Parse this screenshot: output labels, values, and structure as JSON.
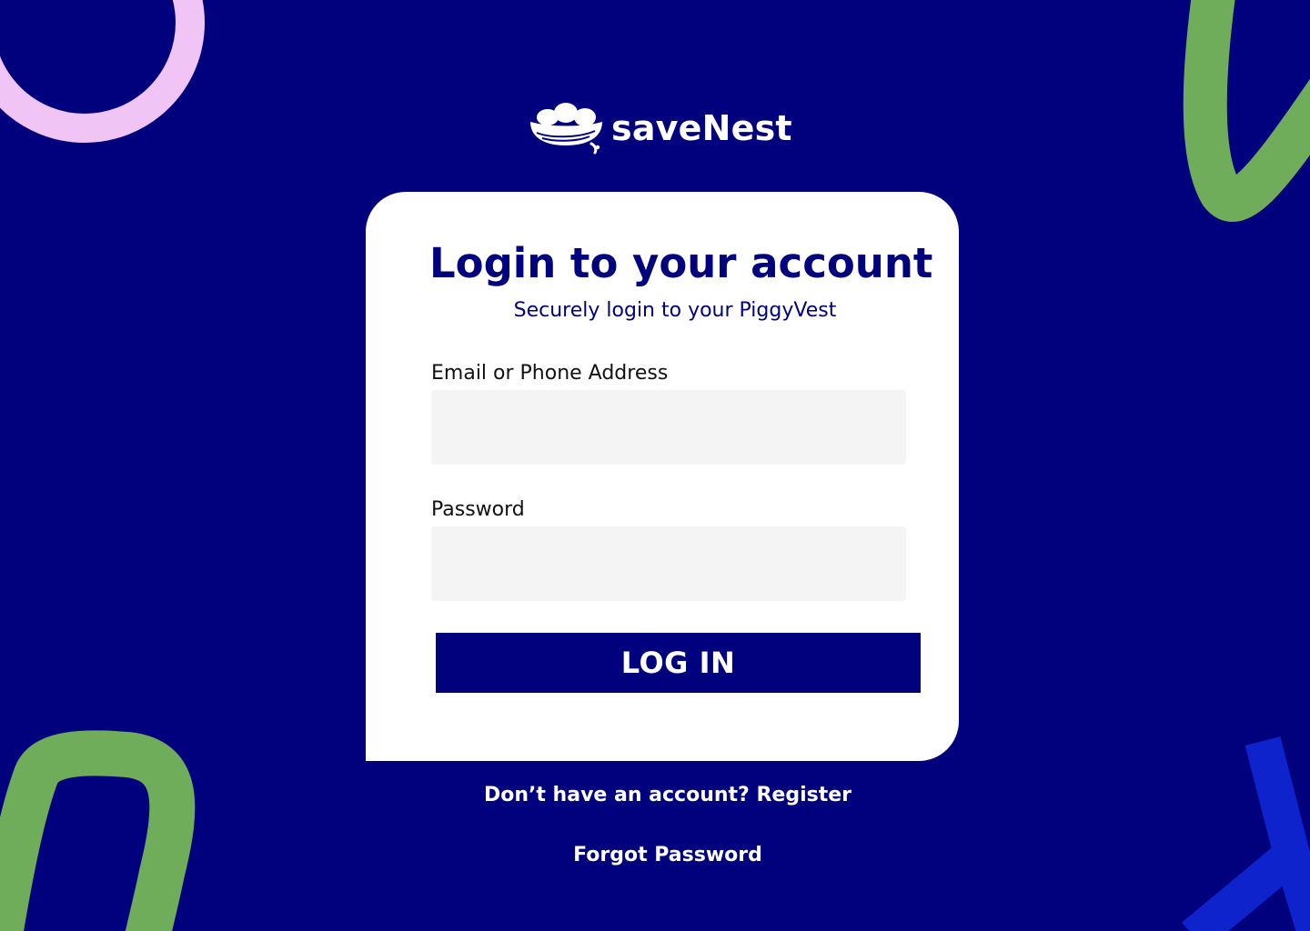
{
  "brand": {
    "name": "saveNest",
    "logo_icon": "nest-with-eggs-icon"
  },
  "colors": {
    "background": "#01017e",
    "card": "#ffffff",
    "primary": "#01017e",
    "input_fill": "#f4f4f4",
    "deco_pink": "#f1c4f6",
    "deco_green": "#70ad5a",
    "deco_blue": "#0f23cc"
  },
  "login": {
    "title": "Login to your account",
    "subtitle": "Securely login to your PiggyVest",
    "email_label": "Email or Phone Address",
    "email_value": "",
    "password_label": "Password",
    "password_value": "",
    "submit_label": "LOG IN"
  },
  "footer": {
    "register_prompt": "Don’t have an account? ",
    "register_link": "Register",
    "forgot_password": "Forgot Password"
  }
}
